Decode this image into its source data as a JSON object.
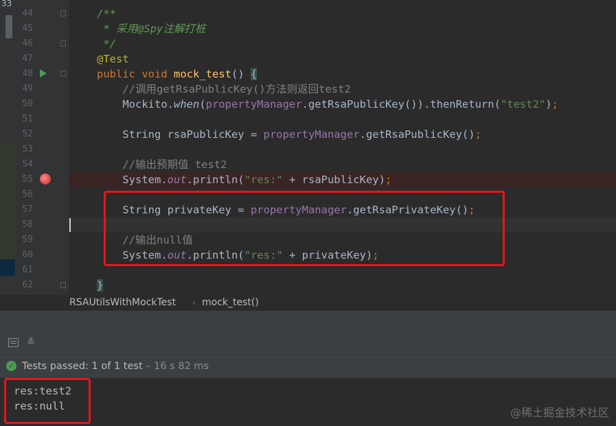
{
  "top_fragment": "33",
  "editor": {
    "lines": [
      {
        "num": "44",
        "tokens": [
          {
            "t": "/**",
            "c": "c-doc"
          }
        ]
      },
      {
        "num": "45",
        "tokens": [
          {
            "t": " * 采用@Spy注解打桩",
            "c": "c-doc"
          }
        ]
      },
      {
        "num": "46",
        "tokens": [
          {
            "t": " */",
            "c": "c-doc"
          }
        ]
      },
      {
        "num": "47",
        "tokens": [
          {
            "t": "@Test",
            "c": "c-ann"
          }
        ]
      },
      {
        "num": "48",
        "tokens": [
          {
            "t": "public ",
            "c": "c-kw"
          },
          {
            "t": "void ",
            "c": "c-kw"
          },
          {
            "t": "mock_test",
            "c": "c-fn"
          },
          {
            "t": "() ",
            "c": ""
          },
          {
            "t": "{",
            "c": "c-brace"
          }
        ]
      },
      {
        "num": "49",
        "tokens": [
          {
            "t": "    //调用getRsaPublicKey()方法则返回test2",
            "c": "c-com"
          }
        ]
      },
      {
        "num": "50",
        "tokens": [
          {
            "t": "    Mockito.",
            "c": ""
          },
          {
            "t": "when",
            "c": "c-smeth"
          },
          {
            "t": "(",
            "c": ""
          },
          {
            "t": "propertyManager",
            "c": "c-field"
          },
          {
            "t": ".getRsaPublicKey()).thenReturn(",
            "c": ""
          },
          {
            "t": "\"test2\"",
            "c": "c-str"
          },
          {
            "t": ")",
            "c": ""
          },
          {
            "t": ";",
            "c": "c-kw"
          }
        ]
      },
      {
        "num": "51",
        "tokens": []
      },
      {
        "num": "52",
        "tokens": [
          {
            "t": "    String rsaPublicKey = ",
            "c": ""
          },
          {
            "t": "propertyManager",
            "c": "c-field"
          },
          {
            "t": ".getRsaPublicKey()",
            "c": ""
          },
          {
            "t": ";",
            "c": "c-kw"
          }
        ]
      },
      {
        "num": "53",
        "tokens": []
      },
      {
        "num": "54",
        "tokens": [
          {
            "t": "    //输出预期值 test2",
            "c": "c-com"
          }
        ]
      },
      {
        "num": "55",
        "tokens": [
          {
            "t": "    System.",
            "c": ""
          },
          {
            "t": "out",
            "c": "c-static"
          },
          {
            "t": ".println(",
            "c": ""
          },
          {
            "t": "\"res:\"",
            "c": "c-str"
          },
          {
            "t": " + rsaPublicKey)",
            "c": ""
          },
          {
            "t": ";",
            "c": "c-kw"
          }
        ]
      },
      {
        "num": "56",
        "tokens": []
      },
      {
        "num": "57",
        "tokens": [
          {
            "t": "    String privateKey = ",
            "c": ""
          },
          {
            "t": "propertyManager",
            "c": "c-field"
          },
          {
            "t": ".getRsaPrivateKey()",
            "c": ""
          },
          {
            "t": ";",
            "c": "c-kw"
          }
        ]
      },
      {
        "num": "58",
        "tokens": []
      },
      {
        "num": "59",
        "tokens": [
          {
            "t": "    //输出null值",
            "c": "c-com"
          }
        ]
      },
      {
        "num": "60",
        "tokens": [
          {
            "t": "    System.",
            "c": ""
          },
          {
            "t": "out",
            "c": "c-static"
          },
          {
            "t": ".println(",
            "c": ""
          },
          {
            "t": "\"res:\"",
            "c": "c-str"
          },
          {
            "t": " + privateKey)",
            "c": ""
          },
          {
            "t": ";",
            "c": "c-kw"
          }
        ]
      },
      {
        "num": "61",
        "tokens": []
      },
      {
        "num": "62",
        "tokens": [
          {
            "t": "}",
            "c": "c-brace"
          }
        ]
      }
    ]
  },
  "breadcrumb": {
    "class_name": "RSAUtilsWithMockTest",
    "separator": "›",
    "method_name": "mock_test()"
  },
  "toolbar": {
    "icon2_glyph": "≚"
  },
  "status": {
    "check_glyph": "✓",
    "passed_label": "Tests passed:",
    "passed_value": "1 of 1 test",
    "duration": "– 16 s 82 ms"
  },
  "console": {
    "lines": [
      "res:test2",
      "res:null"
    ]
  },
  "watermark": "@稀土掘金技术社区",
  "colors": {
    "run_green": "#499c54",
    "breakpoint_red": "#db4d4d",
    "highlight_red": "#e8161b",
    "editor_bg": "#2b2b2b"
  }
}
